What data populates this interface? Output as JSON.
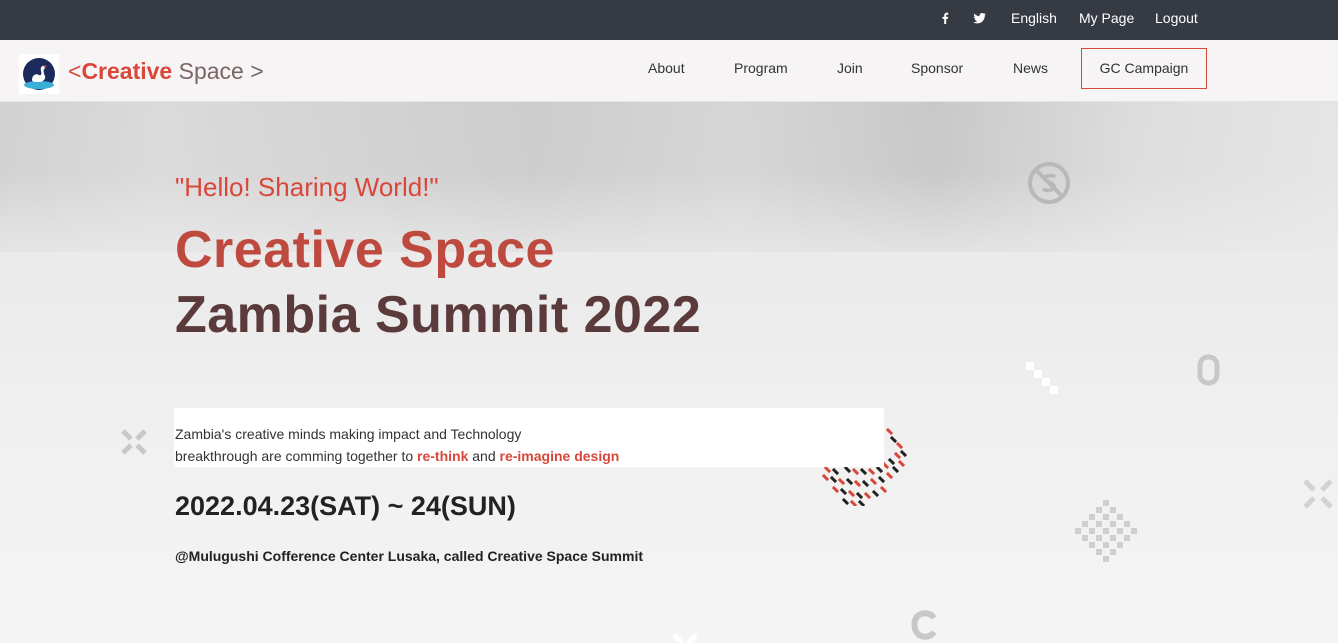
{
  "topbar": {
    "facebook_icon": "facebook-icon",
    "twitter_icon": "twitter-icon",
    "language": "English",
    "my_page": "My Page",
    "logout": "Logout"
  },
  "header": {
    "brand": {
      "open_bracket": "<",
      "bold": "Creative",
      "light": " Space >"
    },
    "nav": {
      "about": "About",
      "program": "Program",
      "join": "Join",
      "sponsor": "Sponsor",
      "news": "News",
      "campaign": "GC Campaign"
    }
  },
  "hero": {
    "tagline": "\"Hello! Sharing World!\"",
    "title_line1": "Creative Space",
    "title_line2": "Zambia Summit 2022",
    "description": {
      "line1": "Zambia's creative minds making impact and Technology",
      "line2_start": "breakthrough are comming together to ",
      "highlight1": "re-think",
      "middle": " and ",
      "highlight2": "re-imagine design"
    },
    "date": "2022.04.23(SAT) ~ 24(SUN)",
    "venue": "@Mulugushi Cofference Center Lusaka, called Creative Space Summit"
  },
  "colors": {
    "accent": "#d9473a",
    "topbar": "#363a42",
    "title_dark": "#5a3a3a"
  }
}
